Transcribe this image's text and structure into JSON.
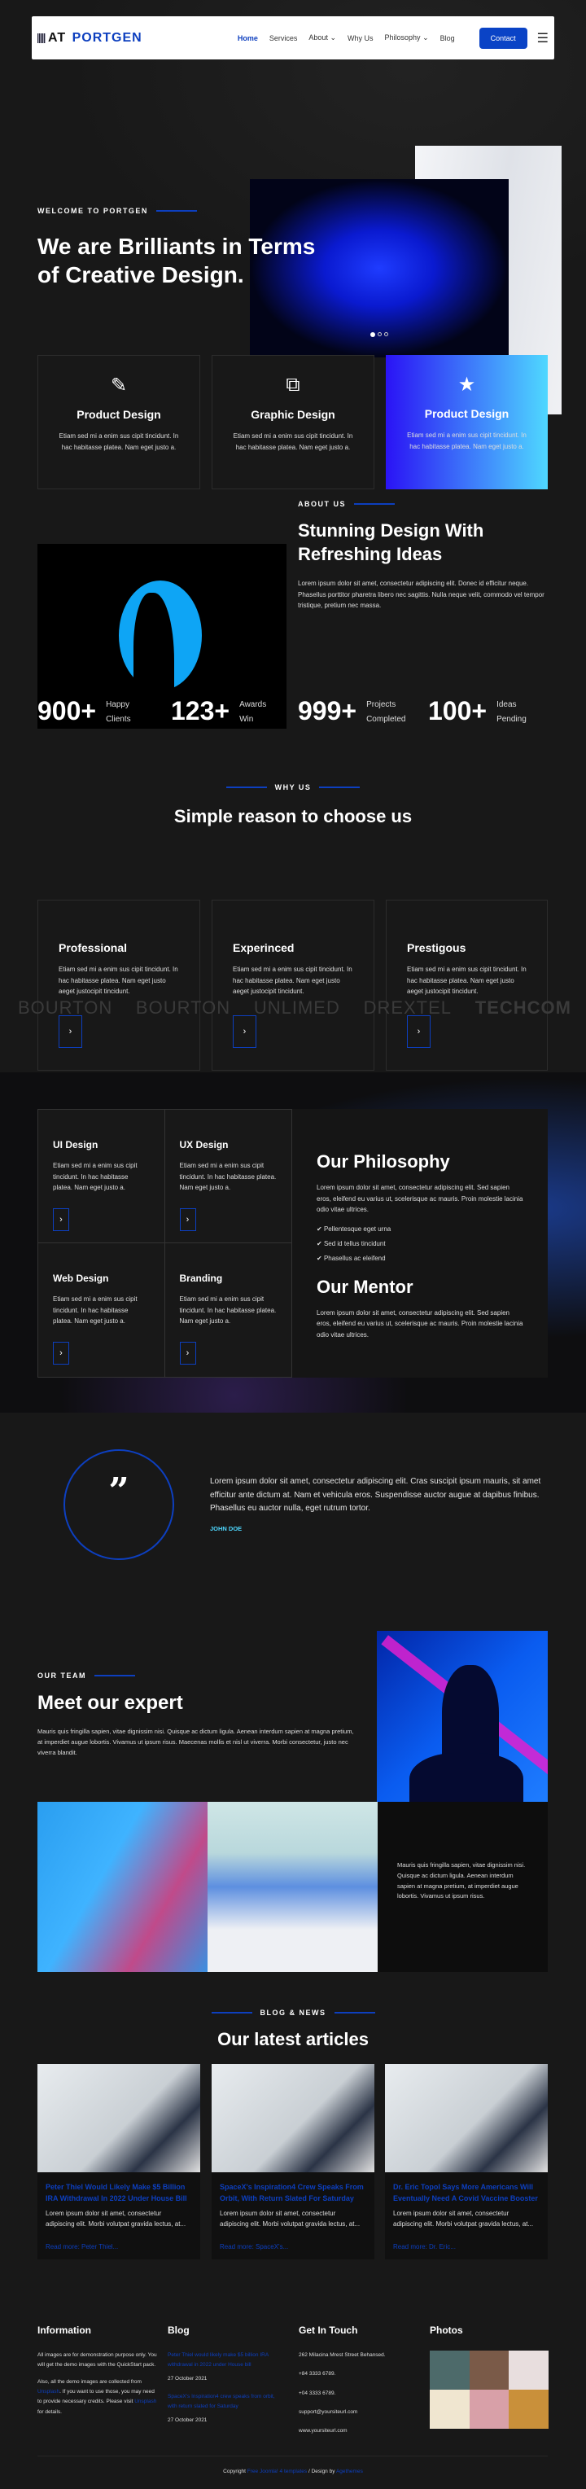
{
  "nav": {
    "logo_mark": "AT",
    "logo_text": "PORTGEN",
    "items": [
      "Home",
      "Services",
      "About",
      "Why Us",
      "Philosophy",
      "Blog"
    ],
    "contact": "Contact",
    "accent": "#0a43c6"
  },
  "hero": {
    "eyebrow": "WELCOME TO PORTGEN",
    "title": "We are Brilliants in Terms of Creative Design.",
    "slides": 3,
    "active_slide": 1
  },
  "services": [
    {
      "icon": "pencil-icon",
      "title": "Product Design",
      "text": "Etiam sed mi a enim sus cipit tincidunt. In hac habitasse platea. Nam eget justo a."
    },
    {
      "icon": "copy-icon",
      "title": "Graphic Design",
      "text": "Etiam sed mi a enim sus cipit tincidunt. In hac habitasse platea. Nam eget justo a."
    },
    {
      "icon": "star-icon",
      "title": "Product Design",
      "text": "Etiam sed mi a enim sus cipit tincidunt. In hac habitasse platea. Nam eget justo a."
    }
  ],
  "about": {
    "eyebrow": "ABOUT US",
    "title": "Stunning Design With Refreshing Ideas",
    "text": "Lorem ipsum dolor sit amet, consectetur adipiscing elit. Donec id efficitur neque. Phasellus porttitor pharetra libero nec sagittis. Nulla neque velit, commodo vel tempor tristique, pretium nec massa."
  },
  "stats": [
    {
      "n": "900+",
      "l1": "Happy",
      "l2": "Clients"
    },
    {
      "n": "123+",
      "l1": "Awards",
      "l2": "Win"
    },
    {
      "n": "999+",
      "l1": "Projects",
      "l2": "Completed"
    },
    {
      "n": "100+",
      "l1": "Ideas",
      "l2": "Pending"
    }
  ],
  "why": {
    "eyebrow": "WHY US",
    "title": "Simple reason to choose us",
    "cards": [
      {
        "title": "Professional",
        "text": "Etiam sed mi a enim sus cipit tincidunt. In hac habitasse platea. Nam eget justo aeget justocipit tincidunt."
      },
      {
        "title": "Experinced",
        "text": "Etiam sed mi a enim sus cipit tincidunt. In hac habitasse platea. Nam eget justo aeget justocipit tincidunt."
      },
      {
        "title": "Prestigous",
        "text": "Etiam sed mi a enim sus cipit tincidunt. In hac habitasse platea. Nam eget justo aeget justocipit tincidunt."
      }
    ]
  },
  "logos": [
    "BOURTON",
    "BOURTON",
    "UNLIMED",
    "DREXTEL",
    "TECHCOM"
  ],
  "philosophy": {
    "cells": [
      {
        "title": "UI Design",
        "text": "Etiam sed mi a enim sus cipit tincidunt. In hac habitasse platea. Nam eget justo a."
      },
      {
        "title": "UX Design",
        "text": "Etiam sed mi a enim sus cipit tincidunt. In hac habitasse platea. Nam eget justo a."
      },
      {
        "title": "Web Design",
        "text": "Etiam sed mi a enim sus cipit tincidunt. In hac habitasse platea. Nam eget justo a."
      },
      {
        "title": "Branding",
        "text": "Etiam sed mi a enim sus cipit tincidunt. In hac habitasse platea. Nam eget justo a."
      }
    ],
    "title": "Our Philosophy",
    "text": "Lorem ipsum dolor sit amet, consectetur adipiscing elit. Sed sapien eros, eleifend eu varius ut, scelerisque ac mauris. Proin molestie lacinia odio vitae ultrices.",
    "checks": [
      "Pellentesque eget urna",
      "Sed id tellus tincidunt",
      "Phasellus ac eleifend"
    ],
    "mentor_title": "Our Mentor",
    "mentor_text": "Lorem ipsum dolor sit amet, consectetur adipiscing elit. Sed sapien eros, eleifend eu varius ut, scelerisque ac mauris. Proin molestie lacinia odio vitae ultrices."
  },
  "testimonial": {
    "quote": "Lorem ipsum dolor sit amet, consectetur adipiscing elit. Cras suscipit ipsum mauris, sit amet efficitur ante dictum at. Nam et vehicula eros. Suspendisse auctor augue at dapibus finibus. Phasellus eu auctor nulla, eget rutrum tortor.",
    "author": "JOHN DOE",
    "author_color": "#4fd8ff"
  },
  "team": {
    "eyebrow": "OUR TEAM",
    "title": "Meet our expert",
    "text": "Mauris quis fringilla sapien, vitae dignissim nisi. Quisque ac dictum ligula. Aenean interdum sapien at magna pretium, at imperdiet augue lobortis. Vivamus ut ipsum risus. Maecenas mollis et nisl ut viverra. Morbi consectetur, justo nec viverra blandit.",
    "text2": "Mauris quis fringilla sapien, vitae dignissim nisi. Quisque ac dictum ligula. Aenean interdum sapien at magna pretium, at imperdiet augue lobortis. Vivamus ut ipsum risus."
  },
  "blog": {
    "eyebrow": "BLOG & NEWS",
    "title": "Our latest articles",
    "posts": [
      {
        "title": "Peter Thiel Would Likely Make $5 Billion IRA Withdrawal In 2022 Under House Bill",
        "text": "Lorem ipsum dolor sit amet, consectetur adipiscing elit. Morbi volutpat gravida lectus, at...",
        "more": "Read more: Peter Thiel..."
      },
      {
        "title": "SpaceX's Inspiration4 Crew Speaks From Orbit, With Return Slated For Saturday",
        "text": "Lorem ipsum dolor sit amet, consectetur adipiscing elit. Morbi volutpat gravida lectus, at...",
        "more": "Read more: SpaceX's..."
      },
      {
        "title": "Dr. Eric Topol Says More Americans Will Eventually Need A Covid Vaccine Booster",
        "text": "Lorem ipsum dolor sit amet, consectetur adipiscing elit. Morbi volutpat gravida lectus, at...",
        "more": "Read more: Dr. Eric..."
      }
    ]
  },
  "footer": {
    "info_title": "Information",
    "info_p1": "All images are for demonstration purpose only. You will get the demo images with the QuickStart pack.",
    "info_p2a": "Also, all the demo images are collected from",
    "unsplash": "Unsplash",
    "info_p2b": ". If you want to use those, you may need to provide necessary credits. Please visit",
    "info_p2c": "for details.",
    "blog_title": "Blog",
    "blog_links": [
      {
        "t": "Peter Thiel would likely make $5 billion IRA withdrawal in 2022 under House bill",
        "d": "27 October 2021"
      },
      {
        "t": "SpaceX's Inspiration4 crew speaks from orbit, with return slated for Saturday",
        "d": "27 October 2021"
      }
    ],
    "touch_title": "Get In Touch",
    "touch": [
      "262 Milacina Mrest Street Behansed.",
      "+84 3333 6789.",
      "+04 3333 6789.",
      "support@yoursiteurl.com",
      "www.yoursiteurl.com"
    ],
    "photos_title": "Photos",
    "copyright": "Copyright",
    "copy_link": "Free Joomla! 4 templates",
    "design_by": "/ Design by",
    "design_link": "Agethemes"
  }
}
